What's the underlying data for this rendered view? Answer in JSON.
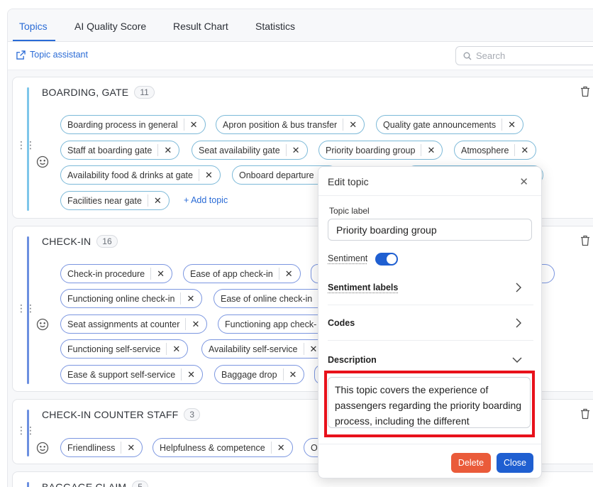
{
  "tabs": [
    "Topics",
    "AI Quality Score",
    "Result Chart",
    "Statistics"
  ],
  "toolbar": {
    "assistant_label": "Topic assistant",
    "search_placeholder": "Search"
  },
  "groups": [
    {
      "name": "BOARDING, GATE",
      "count": "11",
      "chips": [
        "Boarding process in general",
        "Apron position & bus transfer",
        "Quality gate announcements",
        "Staff at boarding gate",
        "Seat availability gate",
        "Priority boarding group",
        "Atmosphere",
        "Availability food & drinks at gate",
        "Onboard departure",
        "Facilities near gate"
      ],
      "add_label": "+ Add topic"
    },
    {
      "name": "CHECK-IN",
      "count": "16",
      "chips": [
        "Check-in procedure",
        "Ease of app check-in",
        "Functioning online check-in",
        "Ease of online check-in",
        "Seat assignments at counter",
        "Functioning app check-",
        "Functioning self-service",
        "Availability self-service",
        "Ease & support self-service",
        "Baggage drop"
      ]
    },
    {
      "name": "CHECK-IN COUNTER STAFF",
      "count": "3",
      "chips": [
        "Friendliness",
        "Helpfulness & competence",
        "Ot"
      ]
    },
    {
      "name": "BAGGAGE CLAIM",
      "count": "5"
    }
  ],
  "modal": {
    "title": "Edit topic",
    "topic_label_caption": "Topic label",
    "topic_label_value": "Priority boarding group",
    "sentiment_label": "Sentiment",
    "sentiment_on": true,
    "sentiment_labels_label": "Sentiment labels",
    "codes_label": "Codes",
    "description_label": "Description",
    "description_text": "This topic covers the experience of passengers regarding the priority boarding process, including the different",
    "delete_label": "Delete",
    "close_label": "Close"
  },
  "colors": {
    "accent": "#2a6bd6",
    "delete": "#ea5b3a",
    "close": "#1f5fd1",
    "highlight": "#e8111b",
    "bar_boarding": "#7ec6ea",
    "bar_checkin": "#6c8fe0"
  }
}
